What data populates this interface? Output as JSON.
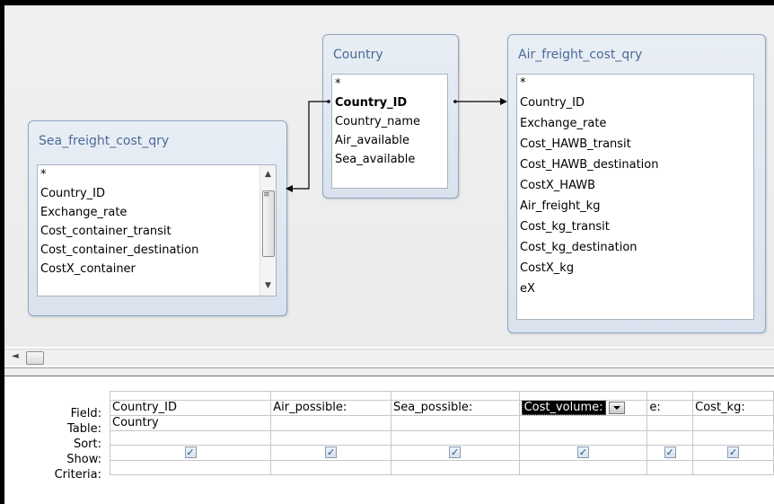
{
  "tables": {
    "sea": {
      "title": "Sea_freight_cost_qry",
      "fields": [
        "*",
        "Country_ID",
        "Exchange_rate",
        "Cost_container_transit",
        "Cost_container_destination",
        "CostX_container"
      ]
    },
    "country": {
      "title": "Country",
      "fields": [
        "*",
        "Country_ID",
        "Country_name",
        "Air_available",
        "Sea_available"
      ]
    },
    "air": {
      "title": "Air_freight_cost_qry",
      "fields": [
        "*",
        "Country_ID",
        "Exchange_rate",
        "Cost_HAWB_transit",
        "Cost_HAWB_destination",
        "CostX_HAWB",
        "Air_freight_kg",
        "Cost_kg_transit",
        "Cost_kg_destination",
        "CostX_kg",
        "eX"
      ]
    }
  },
  "grid": {
    "row_labels": [
      "Field:",
      "Table:",
      "Sort:",
      "Show:",
      "Criteria:"
    ],
    "columns": [
      {
        "field": "Country_ID",
        "table": "Country",
        "show": true
      },
      {
        "field": "Air_possible:",
        "table": "",
        "show": true
      },
      {
        "field": "Sea_possible:",
        "table": "",
        "show": true
      },
      {
        "field": "Cost_volume:",
        "table": "",
        "show": true
      },
      {
        "field": "e:",
        "table": "",
        "show": true
      },
      {
        "field": "Cost_kg:",
        "table": "",
        "show": true
      }
    ],
    "check_glyph": "✓"
  }
}
